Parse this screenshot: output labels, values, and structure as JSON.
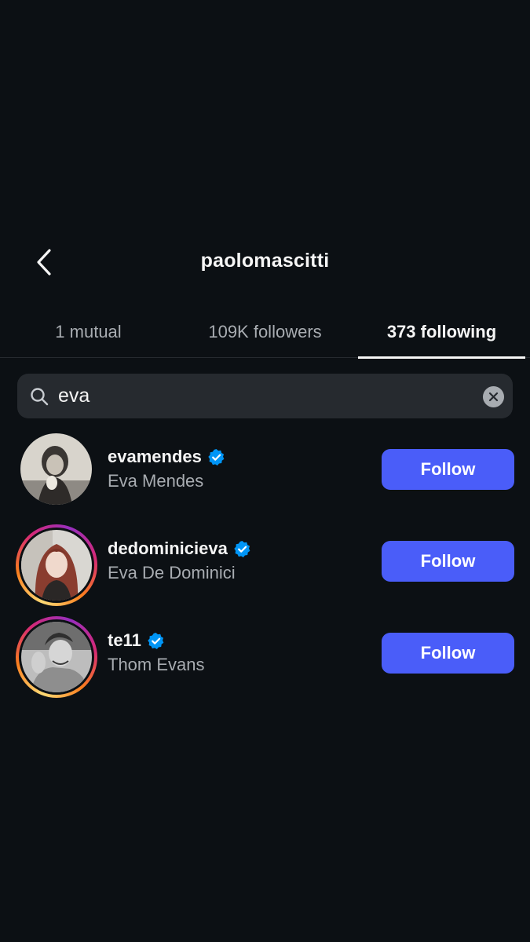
{
  "header": {
    "title": "paolomascitti",
    "back_icon": "chevron-left-icon"
  },
  "tabs": [
    {
      "label": "1 mutual",
      "active": false
    },
    {
      "label": "109K followers",
      "active": false
    },
    {
      "label": "373 following",
      "active": true
    }
  ],
  "search": {
    "value": "eva",
    "search_icon": "search-icon",
    "clear_icon": "clear-icon"
  },
  "users": [
    {
      "username": "evamendes",
      "fullname": "Eva Mendes",
      "verified": true,
      "story_ring": false,
      "button_label": "Follow"
    },
    {
      "username": "dedominicieva",
      "fullname": "Eva De Dominici",
      "verified": true,
      "story_ring": true,
      "button_label": "Follow"
    },
    {
      "username": "te11",
      "fullname": "Thom Evans",
      "verified": true,
      "story_ring": true,
      "button_label": "Follow"
    }
  ],
  "colors": {
    "background": "#0c1014",
    "follow_button": "#4a5df9",
    "verified_badge": "#0095f6",
    "muted_text": "#a8acb1"
  }
}
